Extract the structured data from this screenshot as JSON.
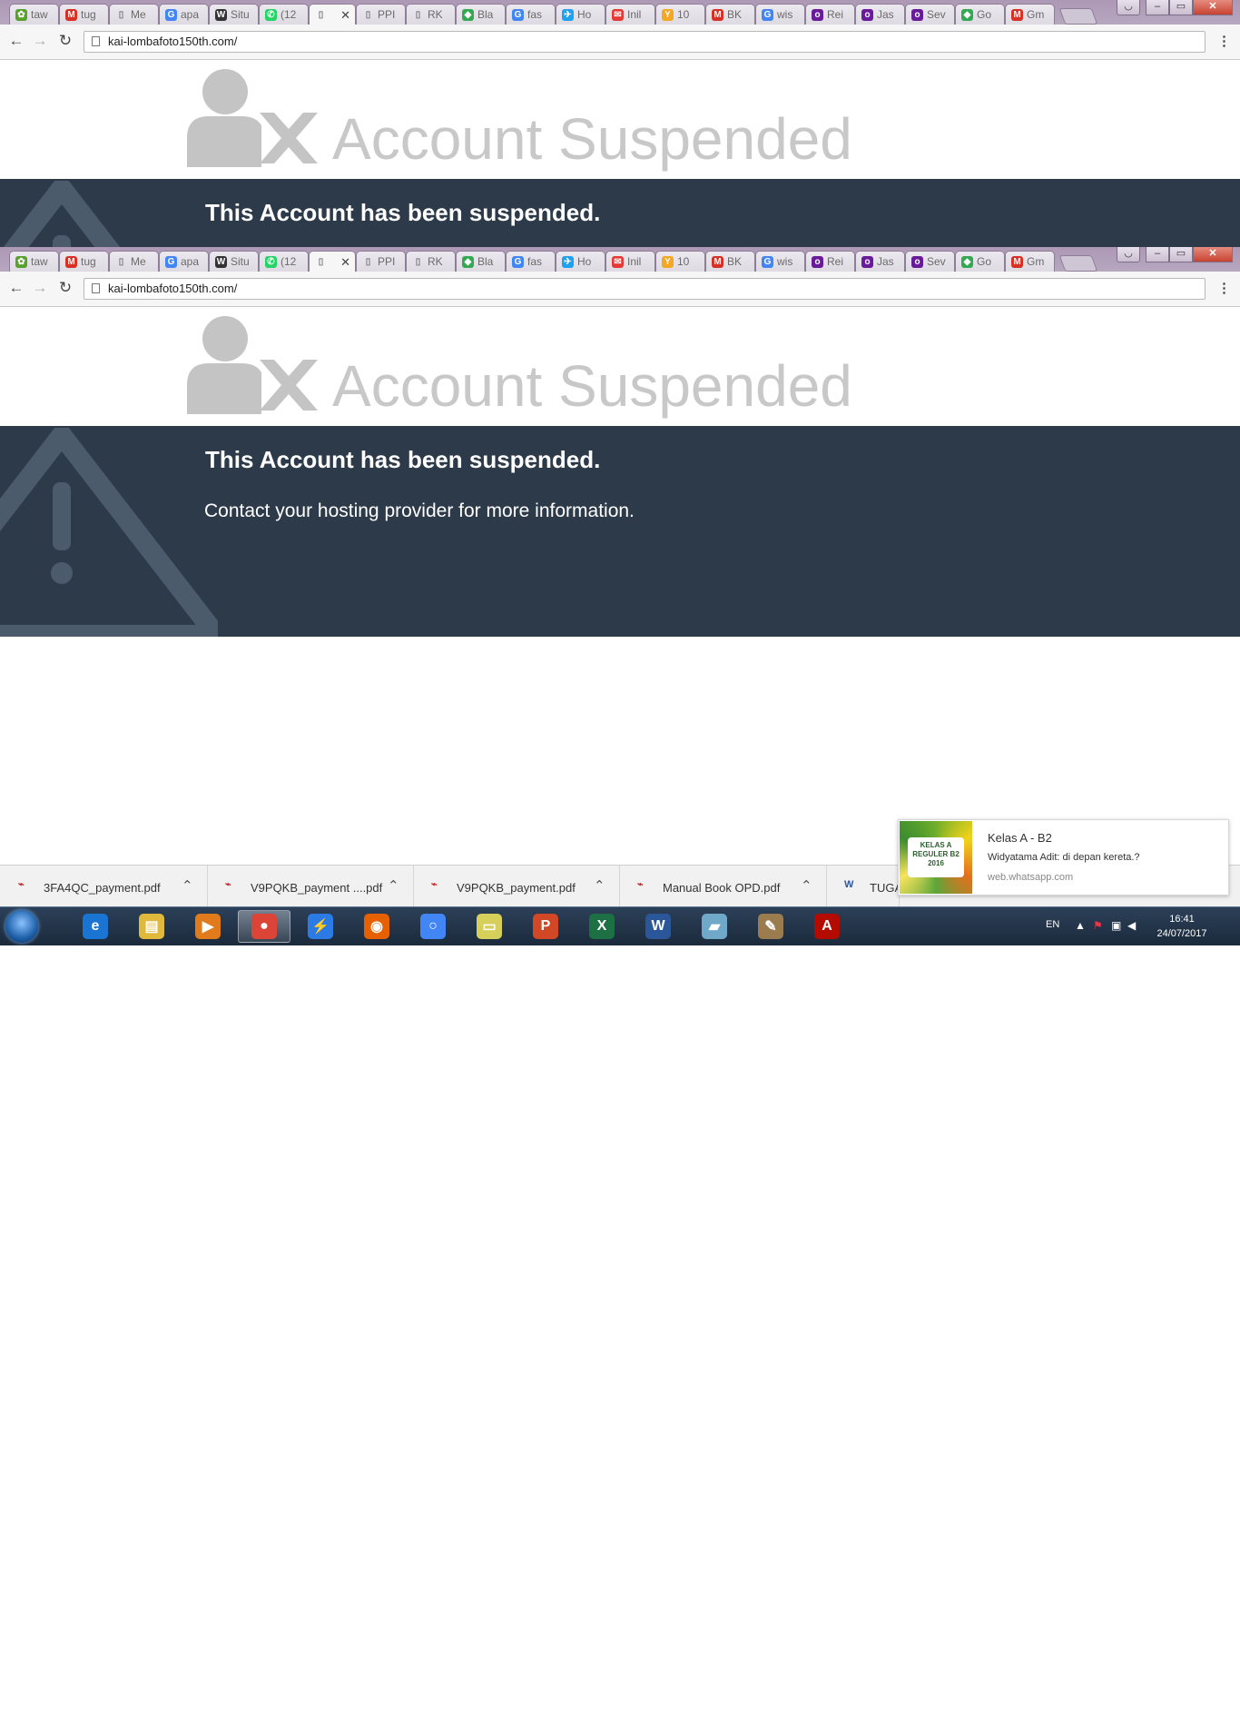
{
  "browser": {
    "tabs": [
      {
        "label": "taw",
        "icon": "leaf-icon",
        "color": "#5aa02c"
      },
      {
        "label": "tug",
        "icon": "gmail-icon",
        "color": "#d93025"
      },
      {
        "label": "Me",
        "icon": "page-icon",
        "color": "#888888"
      },
      {
        "label": "apa",
        "icon": "google-icon",
        "color": "#4285f4"
      },
      {
        "label": "Situ",
        "icon": "wikipedia-icon",
        "color": "#333333"
      },
      {
        "label": "(12",
        "icon": "whatsapp-icon",
        "color": "#25d366"
      },
      {
        "label": "",
        "icon": "page-icon",
        "color": "#888888",
        "active": true
      },
      {
        "label": "PPI",
        "icon": "page-icon",
        "color": "#888888"
      },
      {
        "label": "RK",
        "icon": "page-icon",
        "color": "#888888"
      },
      {
        "label": "Bla",
        "icon": "maps-icon",
        "color": "#34a853"
      },
      {
        "label": "fas",
        "icon": "google-icon",
        "color": "#4285f4"
      },
      {
        "label": "Ho",
        "icon": "bird-icon",
        "color": "#1da1f2"
      },
      {
        "label": "Inil",
        "icon": "mail-icon",
        "color": "#e53935"
      },
      {
        "label": "10",
        "icon": "yahoo-icon",
        "color": "#f5a623"
      },
      {
        "label": "BK",
        "icon": "gmail-icon",
        "color": "#d93025"
      },
      {
        "label": "wis",
        "icon": "google-icon",
        "color": "#4285f4"
      },
      {
        "label": "Rei",
        "icon": "olx-icon",
        "color": "#6a1b9a"
      },
      {
        "label": "Jas",
        "icon": "olx-icon",
        "color": "#6a1b9a"
      },
      {
        "label": "Sev",
        "icon": "olx-icon",
        "color": "#6a1b9a"
      },
      {
        "label": "Go",
        "icon": "maps-icon",
        "color": "#34a853"
      },
      {
        "label": "Gm",
        "icon": "gmail-icon",
        "color": "#d93025"
      }
    ],
    "url": "kai-lombafoto150th.com/"
  },
  "page": {
    "title": "Account Suspended",
    "heading": "This Account has been suspended.",
    "message": "Contact your hosting provider for more information.",
    "band_color": "#2d3a4a"
  },
  "notification": {
    "image_text": "KELAS A REGULER B2",
    "image_subtext": "2016",
    "title": "Kelas A - B2",
    "message": "Widyatama Adit: di depan kereta.?",
    "source": "web.whatsapp.com"
  },
  "downloads": [
    {
      "name": "3FA4QC_payment.pdf",
      "icon": "pdf-icon"
    },
    {
      "name": "V9PQKB_payment ....pdf",
      "icon": "pdf-icon"
    },
    {
      "name": "V9PQKB_payment.pdf",
      "icon": "pdf-icon"
    },
    {
      "name": "Manual Book OPD.pdf",
      "icon": "pdf-icon"
    },
    {
      "name": "TUGAS",
      "icon": "word-doc-icon"
    }
  ],
  "taskbar": {
    "apps": [
      {
        "name": "internet-explorer-icon",
        "glyph": "e",
        "color": "#1a74d1"
      },
      {
        "name": "file-explorer-icon",
        "glyph": "▤",
        "color": "#e0b83c"
      },
      {
        "name": "media-player-icon",
        "glyph": "▶",
        "color": "#e07a1a"
      },
      {
        "name": "chrome-icon",
        "glyph": "●",
        "color": "#db4437",
        "active": true
      },
      {
        "name": "lightning-app-icon",
        "glyph": "⚡",
        "color": "#2c7be5"
      },
      {
        "name": "firefox-icon",
        "glyph": "◉",
        "color": "#e66000"
      },
      {
        "name": "chrome-alt-icon",
        "glyph": "○",
        "color": "#4285f4"
      },
      {
        "name": "sticky-notes-icon",
        "glyph": "▭",
        "color": "#d6cf5a"
      },
      {
        "name": "powerpoint-icon",
        "glyph": "P",
        "color": "#d24726"
      },
      {
        "name": "excel-icon",
        "glyph": "X",
        "color": "#1d7044"
      },
      {
        "name": "word-icon",
        "glyph": "W",
        "color": "#2b579a"
      },
      {
        "name": "notebook-icon",
        "glyph": "▰",
        "color": "#6fa8c9"
      },
      {
        "name": "paint-icon",
        "glyph": "✎",
        "color": "#9b7c4f"
      },
      {
        "name": "acrobat-icon",
        "glyph": "A",
        "color": "#b30b00"
      }
    ],
    "language": "EN",
    "time": "16:41",
    "date": "24/07/2017"
  }
}
